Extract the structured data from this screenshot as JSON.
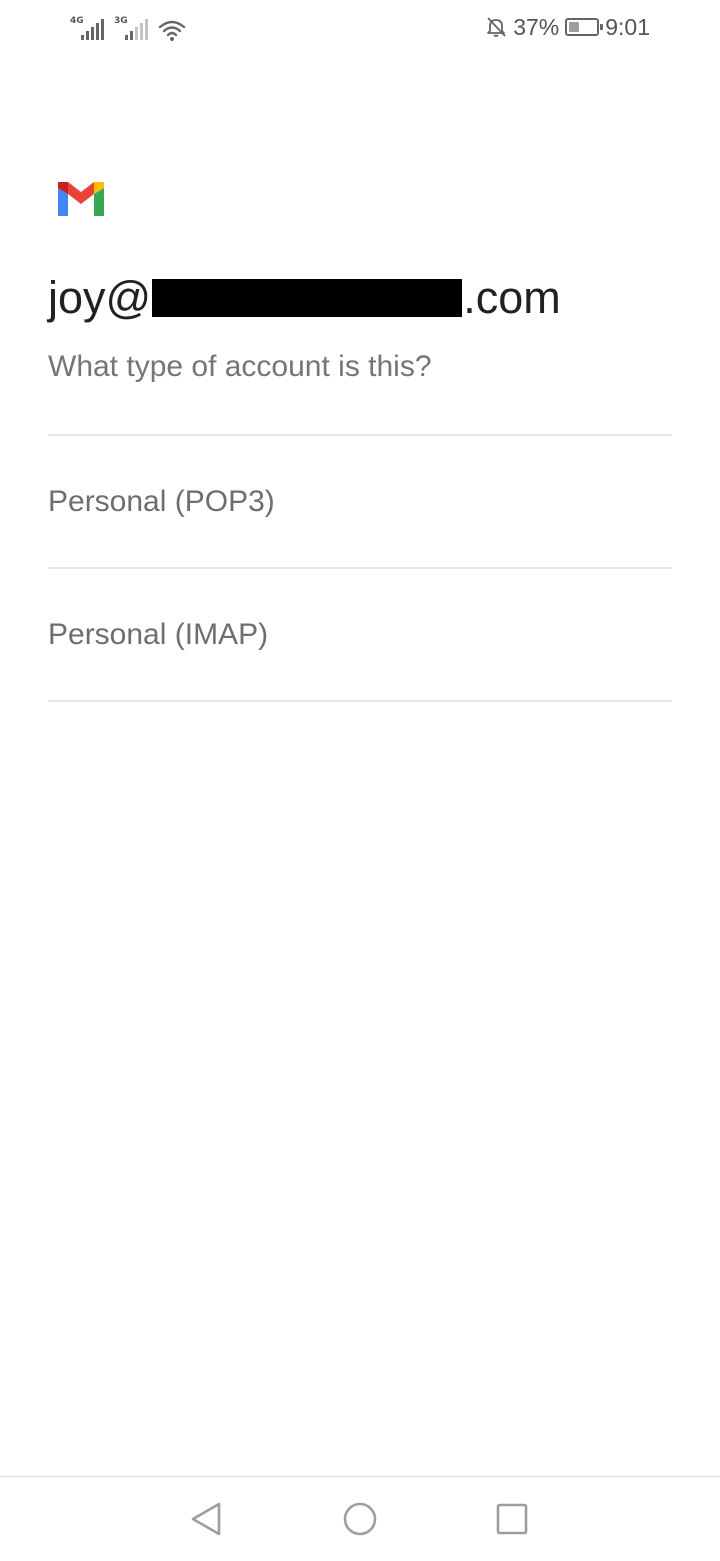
{
  "status_bar": {
    "left": {
      "network1": "4G",
      "network2": "3G"
    },
    "right": {
      "battery_percent": "37%",
      "battery_level": 0.37,
      "time": "9:01"
    }
  },
  "header": {
    "email_prefix": "joy@",
    "email_suffix": ".com",
    "subtitle": "What type of account is this?"
  },
  "options": [
    {
      "label": "Personal (POP3)"
    },
    {
      "label": "Personal (IMAP)"
    }
  ],
  "icons": {
    "logo": "gmail-logo",
    "signal": "cell-signal-icon",
    "wifi": "wifi-icon",
    "mute": "bell-off-icon",
    "battery": "battery-icon",
    "back": "back-icon",
    "home": "home-icon",
    "recents": "recents-icon"
  },
  "colors": {
    "gmail_red": "#EA4335",
    "gmail_blue": "#4285F4",
    "gmail_green": "#34A853",
    "gmail_yellow": "#FBBC04"
  }
}
